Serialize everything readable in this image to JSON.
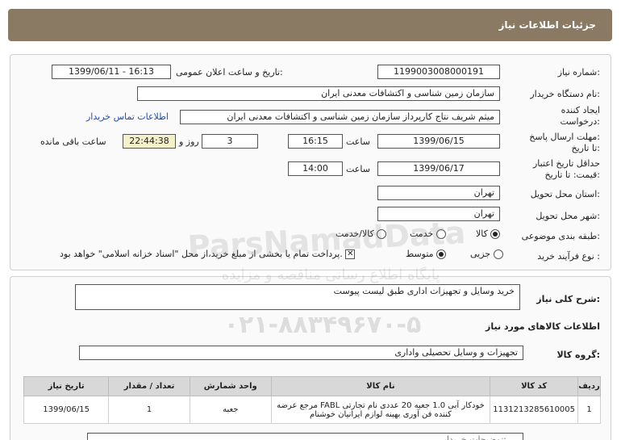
{
  "header": {
    "title": "جزئیات اطلاعات نیاز"
  },
  "form": {
    "need_number_label": "شماره نیاز:",
    "need_number": "1199003008000191",
    "announce_label": "تاریخ و ساعت اعلان عمومی:",
    "announce_value": "1399/06/11 - 16:13",
    "buyer_org_label": "نام دستگاه خریدار:",
    "buyer_org": "سازمان زمین شناسی و اکتشافات معدنی ایران",
    "requester_label_1": "ایجاد کننده",
    "requester_label_2": "درخواست:",
    "requester": "میثم شریف نتاج کارپرداز سازمان زمین شناسی و اکتشافات معدنی ایران",
    "contact_link": "اطلاعات تماس خریدار",
    "send_deadline_label_1": "مهلت ارسال پاسخ:",
    "send_deadline_label_2": "تا تاریخ:",
    "send_date": "1399/06/15",
    "time_label": "ساعت",
    "send_time": "16:15",
    "days_value": "3",
    "days_label": "روز و",
    "remaining_time": "22:44:38",
    "remaining_label": "ساعت باقی مانده",
    "price_valid_label_1": "حداقل تاریخ اعتبار",
    "price_valid_label_2": "قیمت: تا تاریخ:",
    "price_date": "1399/06/17",
    "price_time_label": "ساعت",
    "price_time": "14:00",
    "province_label": "استان محل تحویل:",
    "province": "تهران",
    "city_label": "شهر محل تحویل:",
    "city": "تهران",
    "category_label": "طبقه بندی موضوعی:",
    "category_options": [
      "کالا",
      "خدمت",
      "کالا/خدمت"
    ],
    "category_selected": "کالا",
    "process_label": "نوع فرآیند خرید :",
    "process_options": [
      "جزیی",
      "متوسط"
    ],
    "process_selected": "متوسط",
    "payment_note": "پرداخت تمام یا بخشی از مبلغ خرید،از محل \"اسناد خزانه اسلامی\" خواهد بود."
  },
  "summary": {
    "label": "شرح کلی نیاز:",
    "value": "خرید وسایل و تجهیزات اداری طبق لیست پیوست"
  },
  "goods_section": {
    "title": "اطلاعات کالاهای مورد نیاز",
    "group_label": "گروه کالا:",
    "group_value": "تجهیزات و وسایل تحصیلی واداری"
  },
  "table": {
    "headers": [
      "ردیف",
      "کد کالا",
      "نام کالا",
      "واحد شمارش",
      "تعداد / مقدار",
      "تاریخ نیاز"
    ],
    "rows": [
      {
        "index": "1",
        "code": "1131213285610005",
        "name": "خودکار آبی 1.0 جعبه 20 عددی نام تجارتی FABL مرجع عرضه کننده فن آوری بهینه لوازم ایرانیان خوشنام",
        "unit": "جعبه",
        "qty": "1",
        "date": "1399/06/15"
      }
    ]
  },
  "buyer_notes_partial": "توضیحات خریدار: ... ",
  "watermark": {
    "line1": "ParsNamadData",
    "line2": "پایگاه اطلاع رسانی مناقصه و مزایده",
    "line3": "۰۲۱-۸۸۳۴۹۶۷۰-۵"
  },
  "colors": {
    "header_bg": "#8a7a63",
    "link": "#1b4fb5",
    "remaining_bg": "#f4f1c8"
  }
}
